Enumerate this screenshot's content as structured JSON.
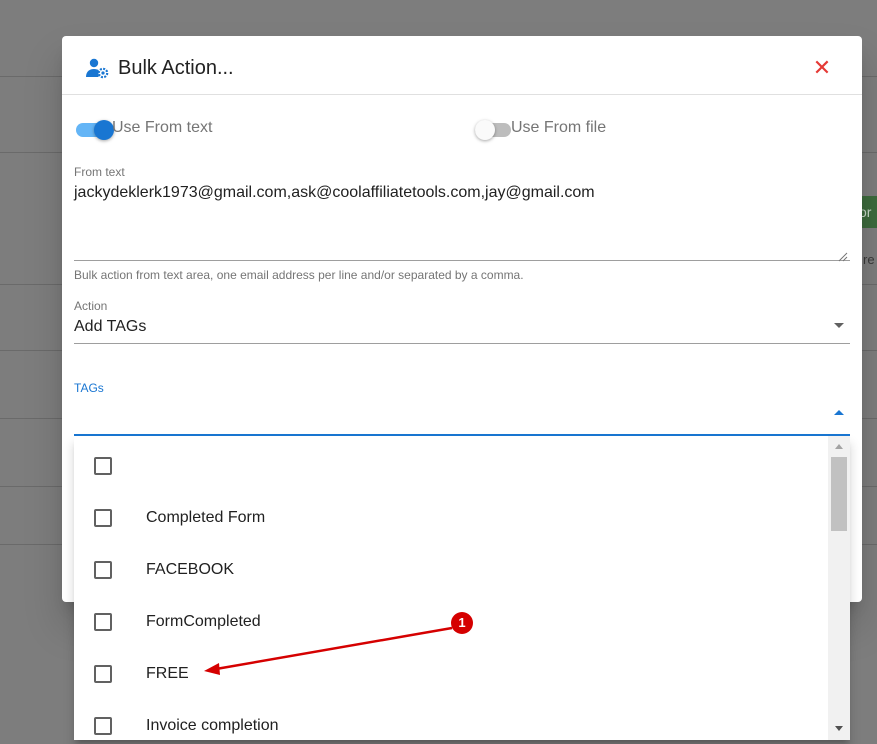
{
  "background": {
    "button_fragment": "or",
    "text_fragment": "re"
  },
  "dialog": {
    "title": "Bulk Action...",
    "title_icon": "user-cog-icon",
    "close_icon": "close-icon",
    "close_symbol": "✕",
    "accent_color": "#1976d2",
    "close_color": "#e53935"
  },
  "switches": {
    "from_text": {
      "label": "Use From text",
      "checked": true
    },
    "from_file": {
      "label": "Use From file",
      "checked": false
    }
  },
  "from_text": {
    "label": "From text",
    "value": "jackydeklerk1973@gmail.com,ask@coolaffiliatetools.com,jay@gmail.com",
    "hint": "Bulk action from text area, one email address per line and/or separated by a comma."
  },
  "action": {
    "label": "Action",
    "value": "Add TAGs"
  },
  "tags": {
    "label": "TAGs",
    "value": ""
  },
  "tag_options": [
    {
      "label": "",
      "checked": false
    },
    {
      "label": "Completed Form",
      "checked": false
    },
    {
      "label": "FACEBOOK",
      "checked": false
    },
    {
      "label": "FormCompleted",
      "checked": false
    },
    {
      "label": "FREE",
      "checked": false
    },
    {
      "label": "Invoice completion",
      "checked": false
    }
  ],
  "annotation": {
    "number": "1",
    "color": "#d50000"
  }
}
